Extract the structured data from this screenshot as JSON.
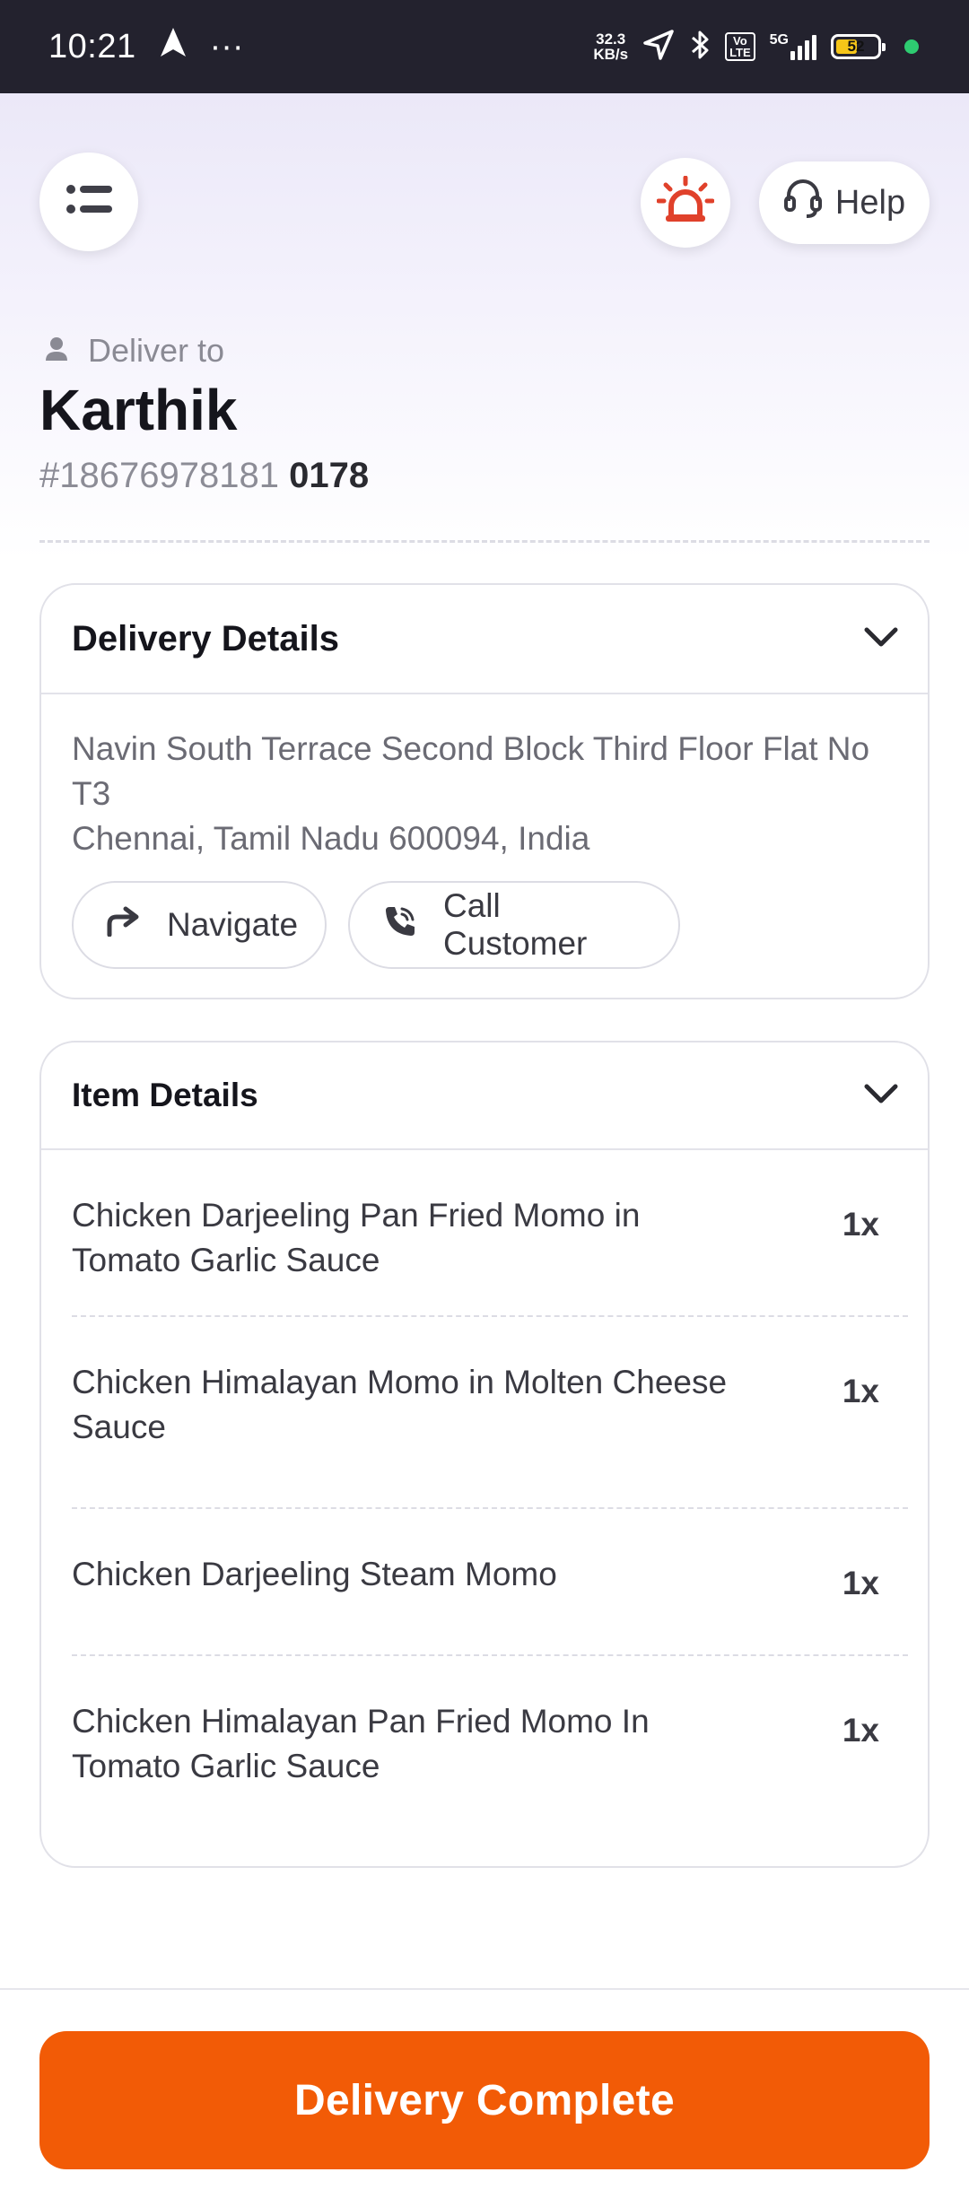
{
  "status_bar": {
    "time": "10:21",
    "more": "···",
    "net_speed_value": "32.3",
    "net_speed_unit": "KB/s",
    "volte_badge_top": "Vo",
    "volte_badge_bottom": "LTE",
    "network_label": "5G",
    "battery_level": "52",
    "battery_fill_fraction": 0.52
  },
  "header": {
    "help_label": "Help",
    "deliver_to_label": "Deliver to",
    "customer_name": "Karthik",
    "order_id_prefix": "#18676978181",
    "order_id_suffix": "0178"
  },
  "delivery_details": {
    "title": "Delivery Details",
    "address_line1": "Navin South Terrace Second Block Third Floor Flat No T3",
    "address_line2": "Chennai, Tamil Nadu 600094, India",
    "navigate_label": "Navigate",
    "call_label": "Call Customer"
  },
  "item_details": {
    "title": "Item Details",
    "items": [
      {
        "name": "Chicken Darjeeling Pan Fried Momo in Tomato Garlic Sauce",
        "qty": "1x"
      },
      {
        "name": "Chicken Himalayan Momo in Molten Cheese Sauce",
        "qty": "1x"
      },
      {
        "name": "Chicken Darjeeling Steam Momo",
        "qty": "1x"
      },
      {
        "name": "Chicken Himalayan Pan Fried Momo In Tomato Garlic Sauce",
        "qty": "1x"
      }
    ]
  },
  "footer": {
    "complete_label": "Delivery Complete"
  },
  "colors": {
    "accent": "#f25b06",
    "sos_red": "#e0412b",
    "status_bar_bg": "#23222e"
  }
}
